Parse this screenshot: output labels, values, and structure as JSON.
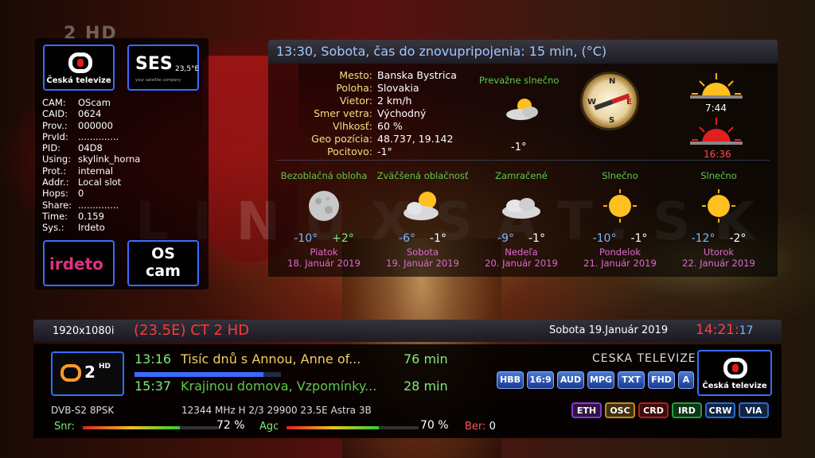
{
  "left_panel": {
    "ct_logo_label": "Česká televize",
    "ses_logo": {
      "name": "SES",
      "position": "23,5°E",
      "tagline": "your satellite company"
    },
    "cam_rows": [
      {
        "key": "CAM:",
        "value": "OScam"
      },
      {
        "key": "CAID:",
        "value": "0624"
      },
      {
        "key": "Prov.:",
        "value": "000000"
      },
      {
        "key": "PrvId:",
        "value": ".............."
      },
      {
        "key": "PID:",
        "value": "04D8"
      },
      {
        "key": "Using:",
        "value": "skylink_horna"
      },
      {
        "key": "Prot.:",
        "value": "internal"
      },
      {
        "key": "Addr.:",
        "value": "Local slot"
      },
      {
        "key": "Hops:",
        "value": "0"
      },
      {
        "key": "Share:",
        "value": ".............."
      },
      {
        "key": "Time:",
        "value": "0.159"
      },
      {
        "key": "Sys.:",
        "value": "Irdeto"
      }
    ],
    "irdeto_logo": "irdeto",
    "oscam_logo": [
      "OS",
      "cam"
    ]
  },
  "channel_top_logo": "2 HD",
  "weather": {
    "title": "13:30, Sobota, čas do znovupripojenia: 15 min, (°C)",
    "info": [
      {
        "key": "Mesto:",
        "value": "Banska Bystrica"
      },
      {
        "key": "Poloha:",
        "value": "Slovakia"
      },
      {
        "key": "Vietor:",
        "value": "2 km/h"
      },
      {
        "key": "Smer vetra:",
        "value": "Východný"
      },
      {
        "key": "Vlhkosť:",
        "value": "60 %"
      },
      {
        "key": "Geo pozícia:",
        "value": "48.737, 19.142"
      },
      {
        "key": "Pocitovo:",
        "value": "-1°"
      }
    ],
    "current_condition": "Prevažne slnečno",
    "current_temp": "-1°",
    "compass": {
      "n": "N",
      "s": "S",
      "w": "W",
      "e": "E"
    },
    "sunrise": "7:44",
    "sunset": "16:36",
    "forecast": [
      {
        "condition": "Bezoblačná obloha",
        "icon": "moon-icon",
        "low": "-10°",
        "high": "+2°",
        "day": "Piatok",
        "date": "18. Január 2019"
      },
      {
        "condition": "Zväčšená oblačnosť",
        "icon": "cloud-sun-icon",
        "low": "-6°",
        "high": "-1°",
        "day": "Sobota",
        "date": "19. Január 2019"
      },
      {
        "condition": "Zamračené",
        "icon": "cloud-icon",
        "low": "-9°",
        "high": "-1°",
        "day": "Nedeľa",
        "date": "20. Január 2019"
      },
      {
        "condition": "Slnečno",
        "icon": "sun-icon",
        "low": "-10°",
        "high": "-1°",
        "day": "Pondelok",
        "date": "21. Január 2019"
      },
      {
        "condition": "Slnečno",
        "icon": "sun-icon",
        "low": "-12°",
        "high": "-2°",
        "day": "Utorok",
        "date": "22. Január 2019"
      }
    ]
  },
  "info_bar": {
    "resolution": "1920x1080i",
    "channel": "(23.5E) CT 2 HD",
    "date": "Sobota  19.Január 2019",
    "clock": "14:21:",
    "clock_sec": "17"
  },
  "epg": {
    "channel_logo": {
      "num": "2",
      "hd": "HD"
    },
    "now": {
      "time": "13:16",
      "title": "Tisíc dnů s Annou, Anne of...",
      "duration": "76 min"
    },
    "next": {
      "time": "15:37",
      "title": "Krajinou domova, Vzpomínky...",
      "duration": "28 min"
    },
    "progress_percent": 88,
    "provider": "CESKA TELEVIZE",
    "badges": [
      "HBB",
      "16:9",
      "AUD",
      "MPG",
      "TXT",
      "FHD",
      "A"
    ],
    "ct_logo_label": "Česká televize"
  },
  "status": {
    "tuner": "DVB-S2  8PSK",
    "transponder": "12344 MHz  H  2/3  29900  23.5E Astra 3B",
    "cas": [
      {
        "label": "ETH",
        "color": "#8a3ad0"
      },
      {
        "label": "OSC",
        "color": "#c08a20"
      },
      {
        "label": "CRD",
        "color": "#b02020"
      },
      {
        "label": "IRD",
        "color": "#20a040"
      },
      {
        "label": "CRW",
        "color": "#2a6ad0"
      },
      {
        "label": "VIA",
        "color": "#2a6ad0"
      }
    ],
    "snr_label": "Snr:",
    "snr_percent": 72,
    "snr_text": "72 %",
    "agc_label": "Agc",
    "agc_percent": 70,
    "agc_text": "70 %",
    "ber_label": "Ber:",
    "ber_value": "0"
  },
  "watermark": "LINUXSAT.SK"
}
